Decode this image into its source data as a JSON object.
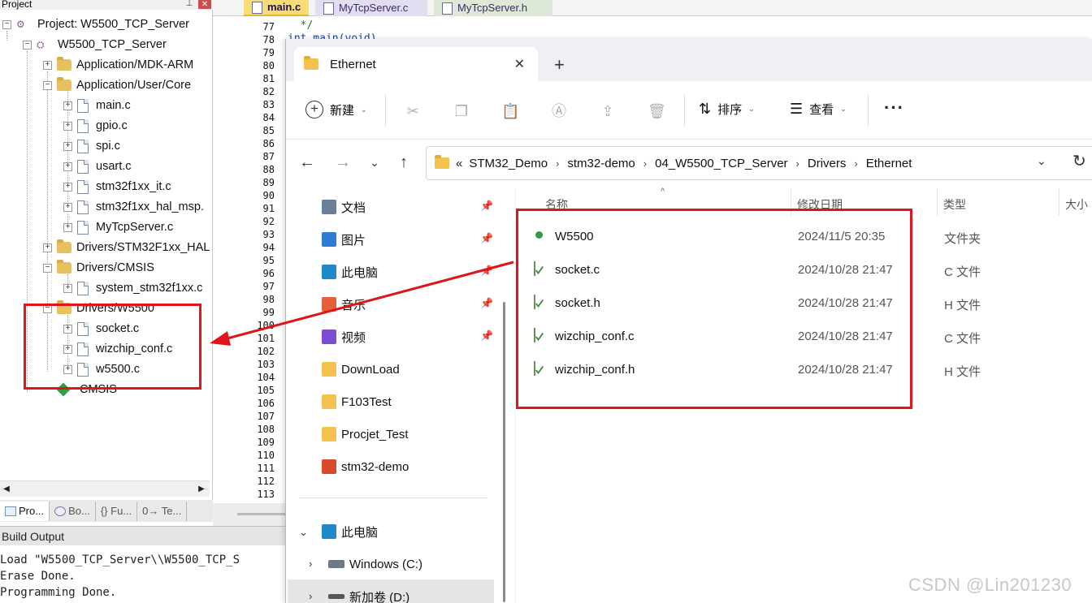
{
  "project_pane": {
    "header": "Project",
    "tree": [
      {
        "label": "Project: W5500_TCP_Server"
      },
      {
        "label": "W5500_TCP_Server"
      },
      {
        "label": "Application/MDK-ARM"
      },
      {
        "label": "Application/User/Core"
      },
      {
        "label": "main.c"
      },
      {
        "label": "gpio.c"
      },
      {
        "label": "spi.c"
      },
      {
        "label": "usart.c"
      },
      {
        "label": "stm32f1xx_it.c"
      },
      {
        "label": "stm32f1xx_hal_msp."
      },
      {
        "label": "MyTcpServer.c"
      },
      {
        "label": "Drivers/STM32F1xx_HAL"
      },
      {
        "label": "Drivers/CMSIS"
      },
      {
        "label": "system_stm32f1xx.c"
      },
      {
        "label": "Drivers/W5500"
      },
      {
        "label": "socket.c"
      },
      {
        "label": "wizchip_conf.c"
      },
      {
        "label": "w5500.c"
      },
      {
        "label": "CMSIS"
      }
    ],
    "tabs": [
      "Pro...",
      "Bo...",
      "{} Fu...",
      "0→ Te..."
    ]
  },
  "editor": {
    "tabs": [
      "main.c",
      "MyTcpServer.c",
      "MyTcpServer.h"
    ],
    "line_numbers": [
      "77",
      "78",
      "79",
      "80",
      "81",
      "82",
      "83",
      "84",
      "85",
      "86",
      "87",
      "88",
      "89",
      "90",
      "91",
      "92",
      "93",
      "94",
      "95",
      "96",
      "97",
      "98",
      "99",
      "100",
      "101",
      "102",
      "103",
      "104",
      "105",
      "106",
      "107",
      "108",
      "109",
      "110",
      "111",
      "112",
      "113"
    ],
    "code": [
      "  */",
      "int main(void)"
    ]
  },
  "build_output": {
    "title": "Build Output",
    "lines": [
      "Load \"W5500_TCP_Server\\\\W5500_TCP_S",
      "Erase Done.",
      "Programming Done."
    ]
  },
  "explorer": {
    "tab_title": "Ethernet",
    "toolbar": {
      "new_label": "新建",
      "sort_label": "排序",
      "view_label": "查看",
      "more": "···"
    },
    "breadcrumb": [
      "STM32_Demo",
      "stm32-demo",
      "04_W5500_TCP_Server",
      "Drivers",
      "Ethernet"
    ],
    "breadcrumb_prefix": "«",
    "nav": {
      "quick_access": [
        {
          "label": "文档",
          "color": "#6b7f99"
        },
        {
          "label": "图片",
          "color": "#2f7bd6"
        },
        {
          "label": "此电脑",
          "color": "#1e88c9"
        },
        {
          "label": "音乐",
          "color": "#e2603a"
        },
        {
          "label": "视频",
          "color": "#7c4dd0"
        },
        {
          "label": "DownLoad",
          "color": "#f2c14e"
        },
        {
          "label": "F103Test",
          "color": "#f2c14e"
        },
        {
          "label": "Procjet_Test",
          "color": "#f2c14e"
        },
        {
          "label": "stm32-demo",
          "color": "#d84b2a"
        }
      ],
      "this_pc": "此电脑",
      "drives": [
        "Windows (C:)",
        "新加卷 (D:)"
      ]
    },
    "columns": {
      "name": "名称",
      "date": "修改日期",
      "type": "类型",
      "size": "大小"
    },
    "files": [
      {
        "name": "W5500",
        "date": "2024/11/5 20:35",
        "type": "文件夹",
        "kind": "folder"
      },
      {
        "name": "socket.c",
        "date": "2024/10/28 21:47",
        "type": "C 文件",
        "kind": "c"
      },
      {
        "name": "socket.h",
        "date": "2024/10/28 21:47",
        "type": "H 文件",
        "kind": "c"
      },
      {
        "name": "wizchip_conf.c",
        "date": "2024/10/28 21:47",
        "type": "C 文件",
        "kind": "c"
      },
      {
        "name": "wizchip_conf.h",
        "date": "2024/10/28 21:47",
        "type": "H 文件",
        "kind": "c"
      }
    ]
  },
  "watermark": "CSDN @Lin201230",
  "colors": {
    "annotation_red": "#e0151b",
    "folder_yellow": "#f2c14e",
    "keil_active_tab": "#f7dd74"
  }
}
